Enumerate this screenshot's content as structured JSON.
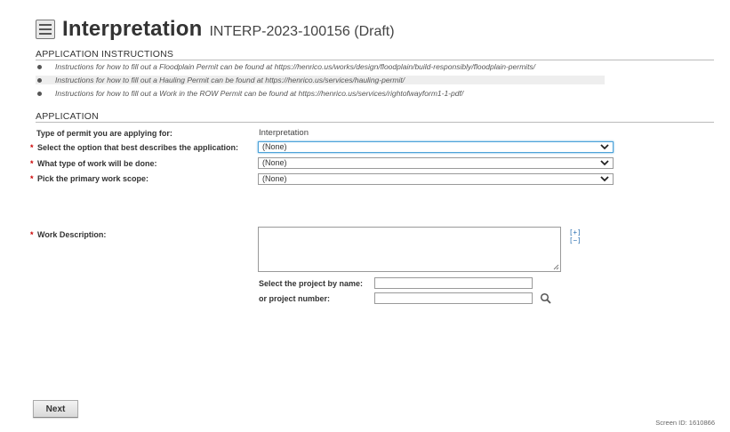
{
  "header": {
    "icon": "document-icon",
    "title": "Interpretation",
    "record_id": "INTERP-2023-100156 (Draft)"
  },
  "instructions_section": {
    "title": "APPLICATION INSTRUCTIONS",
    "items": [
      "Instructions for how to fill out a Floodplain Permit can be found at https://henrico.us/works/design/floodplain/build-responsibly/floodplain-permits/",
      "Instructions for how to fill out a Hauling Permit can be found at https://henrico.us/services/hauling-permit/",
      "Instructions for how to fill out a Work in the ROW Permit can be found at https://henrico.us/services/rightofwayform1-1-pdf/"
    ]
  },
  "application_section": {
    "title": "APPLICATION",
    "permit_type_label": "Type of permit you are applying for:",
    "permit_type_value": "Interpretation",
    "required_marker": "*",
    "fields": {
      "application_option": {
        "label": "Select the option that best describes the application:",
        "value": "(None)"
      },
      "work_type": {
        "label": "What type of work will be done:",
        "value": "(None)"
      },
      "work_scope": {
        "label": "Pick the primary work scope:",
        "value": "(None)"
      },
      "work_description": {
        "label": "Work Description:",
        "value": "",
        "expand": "[+]",
        "collapse": "[−]"
      }
    },
    "project_name_label": "Select the project by name:",
    "project_name_value": "",
    "project_number_label": "or project number:",
    "project_number_value": ""
  },
  "footer": {
    "next_label": "Next",
    "screen_id": "Screen ID: 1610866"
  },
  "colors": {
    "required": "#cc0000",
    "focus": "#4da3d9",
    "link": "#2a6fb0"
  }
}
